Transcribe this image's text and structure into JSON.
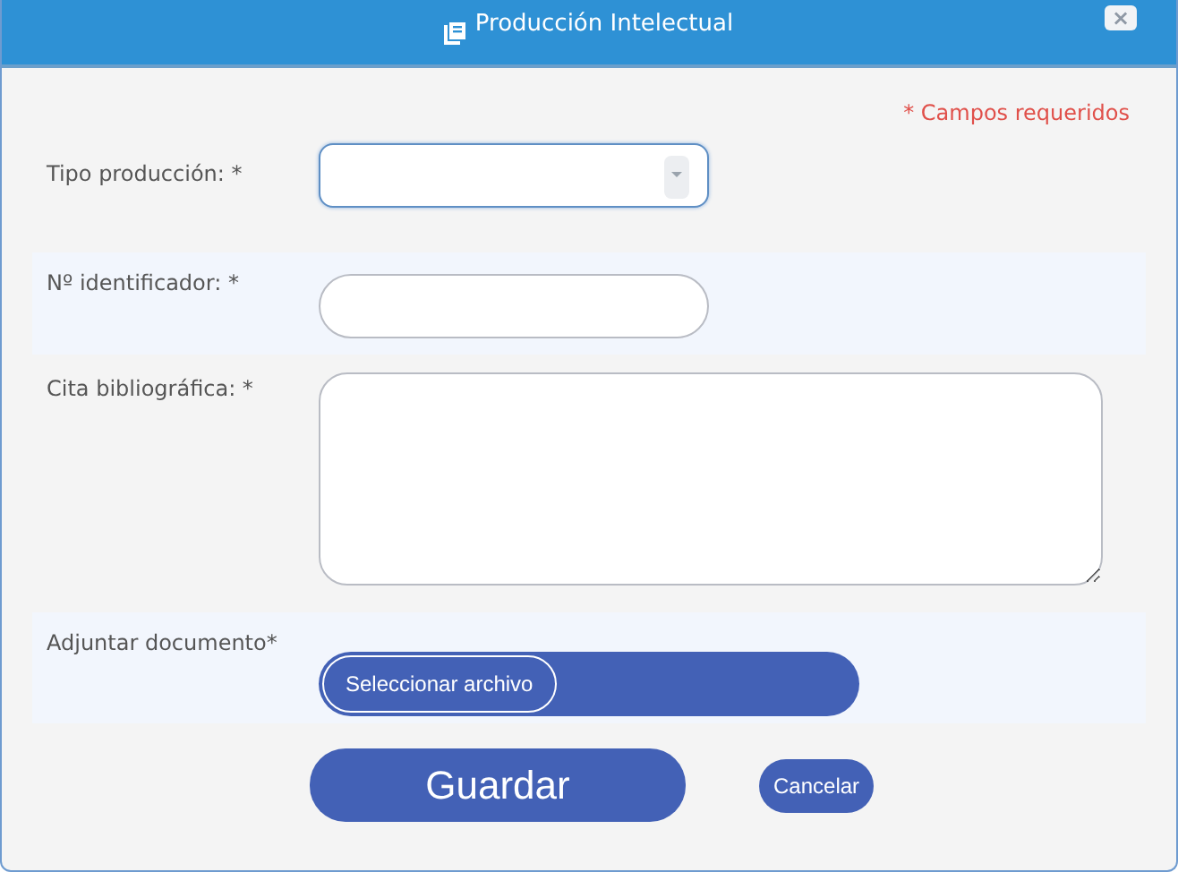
{
  "window": {
    "title": "Producción Intelectual",
    "close_label": "×"
  },
  "required_note": "* Campos requeridos",
  "fields": [
    {
      "kind": "select",
      "label": "Tipo producción: *",
      "focused": true
    },
    {
      "kind": "text",
      "label": "Nº identificador: *",
      "focused": false
    },
    {
      "kind": "textarea",
      "label": "Cita bibliográfica: *",
      "focused": false
    },
    {
      "kind": "file",
      "label": "Adjuntar documento*",
      "button": "Seleccionar archivo",
      "focused": false
    }
  ],
  "buttons": [
    {
      "label": "Guardar",
      "kind": "primary"
    },
    {
      "label": "Cancelar",
      "kind": "secondary"
    }
  ]
}
